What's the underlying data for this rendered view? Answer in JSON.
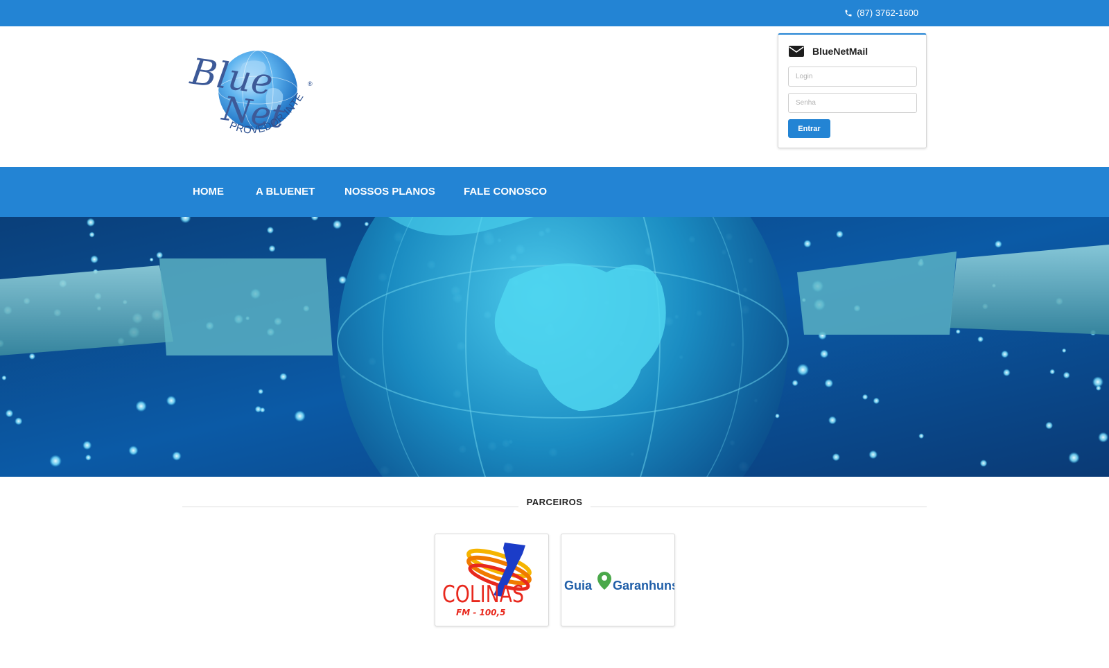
{
  "topbar": {
    "phone": "(87) 3762-1600",
    "phone_icon": "phone-icon"
  },
  "logo": {
    "word1": "Blue",
    "word2": "Net",
    "tagline": "PROVEDOR INTERNET",
    "registered": "®"
  },
  "mail_box": {
    "title": "BlueNetMail",
    "icon": "envelope-icon",
    "login_placeholder": "Login",
    "password_placeholder": "Senha",
    "submit_label": "Entrar"
  },
  "nav": {
    "items": [
      {
        "label": "HOME"
      },
      {
        "label": "A BLUENET"
      },
      {
        "label": "NOSSOS PLANOS"
      },
      {
        "label": "FALE CONOSCO"
      }
    ]
  },
  "partners": {
    "title": "PARCEIROS",
    "items": [
      {
        "name": "COLINAS",
        "subtitle": "FM - 100,5"
      },
      {
        "name_part1": "Guia",
        "name_part2": "Garanhuns"
      }
    ]
  },
  "colors": {
    "brand_blue": "#2384d4",
    "logo_blue": "#2b4f8f",
    "colinas_red": "#e8281d",
    "guia_green": "#4aa84a",
    "guia_blue": "#1f5ea8"
  }
}
